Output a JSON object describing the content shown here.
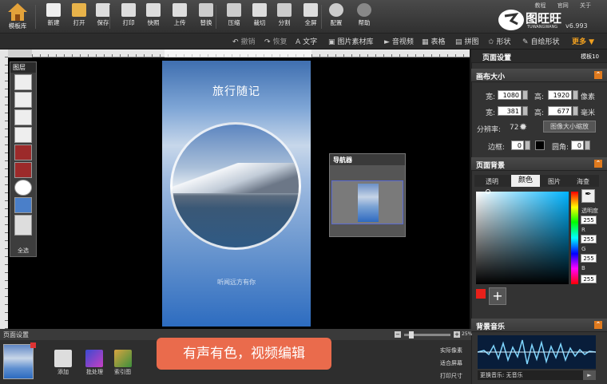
{
  "app": {
    "brand": "图旺旺",
    "brand_en": "TUWANGWANG",
    "version": "v6.993",
    "links": [
      "教程",
      "官网",
      "关于"
    ]
  },
  "toolbar": {
    "home": "模板库",
    "items": [
      "新建",
      "打开",
      "保存",
      "打印",
      "快照",
      "上传",
      "替换",
      "压缩",
      "裁切",
      "分割",
      "全屏",
      "配置",
      "帮助"
    ]
  },
  "toolbar2": {
    "undo": "撤销",
    "redo": "恢复",
    "items": [
      "文字",
      "图片素材库",
      "音视频",
      "表格",
      "拼图",
      "形状",
      "自绘形状"
    ],
    "more": "更多"
  },
  "layers": {
    "title": "图层",
    "select_all": "全选"
  },
  "canvas": {
    "title": "旅行随记",
    "subtitle": "听闻远方有你"
  },
  "navigator": {
    "title": "导航器"
  },
  "right_panel": {
    "header": "页面设置",
    "header_right": "模板10",
    "canvas_size": {
      "title": "画布大小",
      "width_label": "宽:",
      "height_label": "高:",
      "width_px": "1080",
      "height_px": "1920",
      "unit_px": "像素",
      "width_mm": "381",
      "height_mm": "677",
      "unit_mm": "毫米",
      "dpi_label": "分辨率:",
      "dpi": "72",
      "scale_btn": "图像大小缩放",
      "border_label": "边框:",
      "border": "0",
      "radius_label": "圆角:",
      "radius": "0"
    },
    "background": {
      "title": "页面背景",
      "tabs": [
        "透明",
        "颜色",
        "图片",
        "海查"
      ],
      "active_tab": "颜色",
      "opacity_label": "透明度",
      "opacity": "255",
      "r_label": "R",
      "r": "255",
      "g_label": "G",
      "g": "255",
      "b_label": "B",
      "b": "255",
      "swatch": "#e8201a"
    },
    "music": {
      "title": "背景音乐",
      "change": "更换音乐: 无音乐"
    }
  },
  "bottom": {
    "title": "页面设置",
    "add": "添加",
    "batch": "批处理",
    "index": "索引图",
    "zoom": "25%",
    "actual": "实际像素",
    "fit": "适合屏幕",
    "print": "打印尺寸"
  },
  "toast": "有声有色，视频编辑"
}
